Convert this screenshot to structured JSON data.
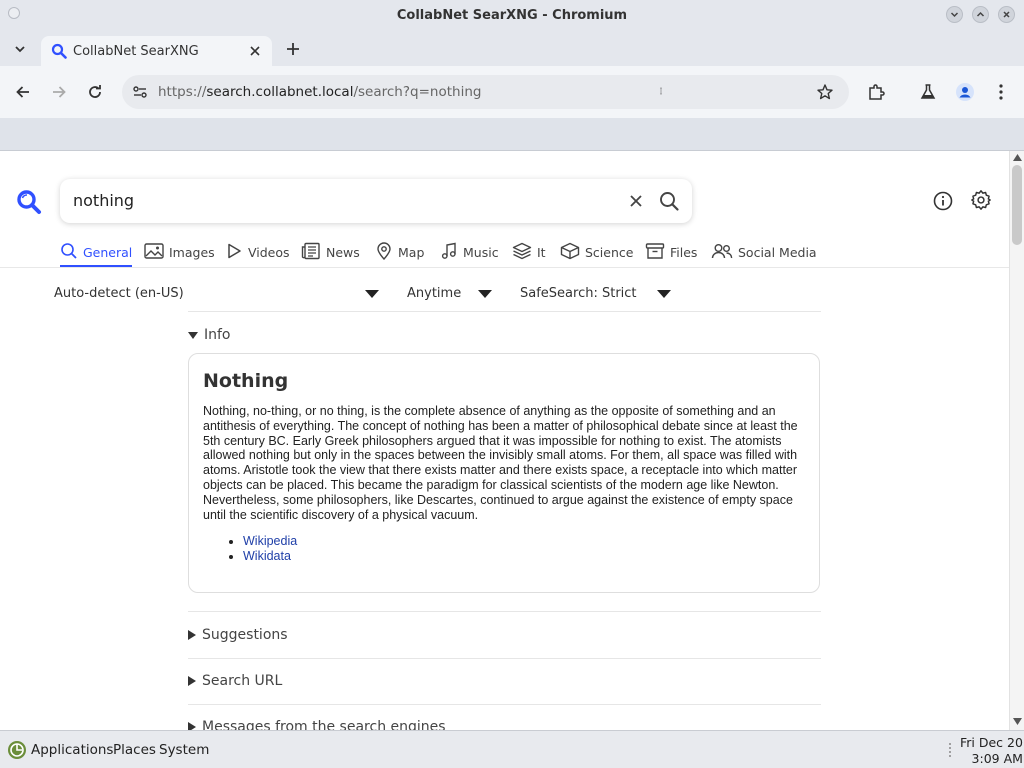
{
  "window": {
    "title": "CollabNet SearXNG - Chromium"
  },
  "tab": {
    "title": "CollabNet SearXNG"
  },
  "address_bar": {
    "scheme": "https://",
    "host": "search.collabnet.local",
    "path": "/search?q=nothing"
  },
  "search": {
    "query": "nothing"
  },
  "categories": [
    {
      "label": "General",
      "icon": "search-icon",
      "active": true
    },
    {
      "label": "Images",
      "icon": "image-icon"
    },
    {
      "label": "Videos",
      "icon": "play-icon"
    },
    {
      "label": "News",
      "icon": "newspaper-icon"
    },
    {
      "label": "Map",
      "icon": "map-pin-icon"
    },
    {
      "label": "Music",
      "icon": "music-note-icon"
    },
    {
      "label": "It",
      "icon": "layers-icon"
    },
    {
      "label": "Science",
      "icon": "cube-icon"
    },
    {
      "label": "Files",
      "icon": "archive-icon"
    },
    {
      "label": "Social Media",
      "icon": "people-icon"
    }
  ],
  "filters": {
    "language": "Auto-detect (en-US)",
    "time_range": "Anytime",
    "safesearch": "SafeSearch: Strict"
  },
  "info": {
    "summary": "Info",
    "title": "Nothing",
    "description": "Nothing, no-thing, or no thing, is the complete absence of anything as the opposite of something and an antithesis of everything. The concept of nothing has been a matter of philosophical debate since at least the 5th century BC. Early Greek philosophers argued that it was impossible for nothing to exist. The atomists allowed nothing but only in the spaces between the invisibly small atoms. For them, all space was filled with atoms. Aristotle took the view that there exists matter and there exists space, a receptacle into which matter objects can be placed. This became the paradigm for classical scientists of the modern age like Newton. Nevertheless, some philosophers, like Descartes, continued to argue against the existence of empty space until the scientific discovery of a physical vacuum.",
    "links": [
      "Wikipedia",
      "Wikidata"
    ]
  },
  "sections": {
    "suggestions": "Suggestions",
    "search_url": "Search URL",
    "messages": "Messages from the search engines"
  },
  "taskbar": {
    "applications": "Applications",
    "places": "Places",
    "system": "System",
    "date": "Fri Dec 20",
    "time": "3:09 AM"
  },
  "colors": {
    "accent": "#3050ff",
    "link": "#1f3fa8"
  }
}
